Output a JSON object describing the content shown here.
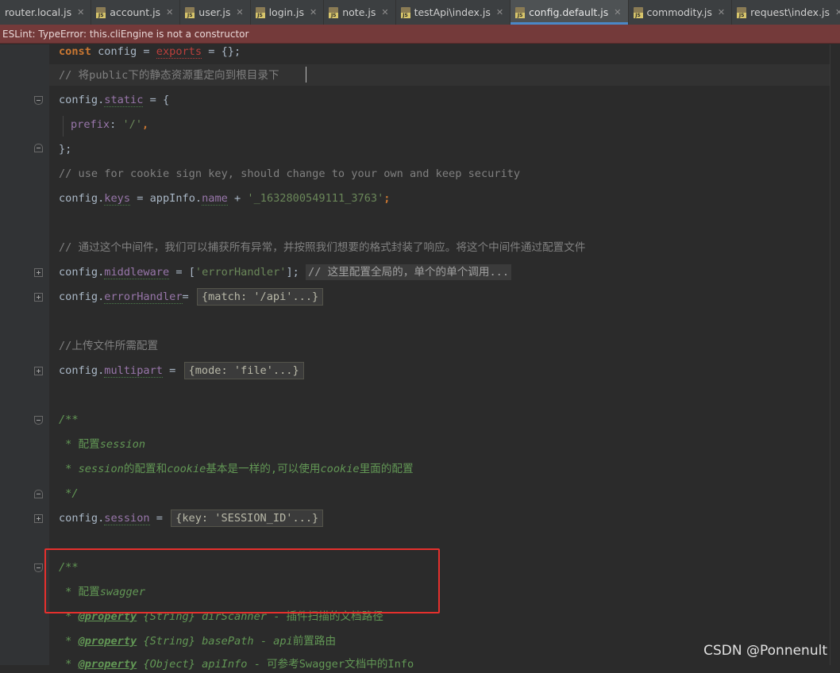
{
  "tabs": [
    {
      "label": "router.local.js",
      "active": false
    },
    {
      "label": "account.js",
      "active": false
    },
    {
      "label": "user.js",
      "active": false
    },
    {
      "label": "login.js",
      "active": false
    },
    {
      "label": "note.js",
      "active": false
    },
    {
      "label": "testApi\\index.js",
      "active": false
    },
    {
      "label": "config.default.js",
      "active": true
    },
    {
      "label": "commodity.js",
      "active": false
    },
    {
      "label": "request\\index.js",
      "active": false
    }
  ],
  "error_banner": "ESLint: TypeError: this.cliEngine is not a constructor",
  "code": {
    "l1_const": "const",
    "l1_a": " config = ",
    "l1_exports": "exports",
    "l1_b": " = {};",
    "l2": "// 将public下的静态资源重定向到根目录下",
    "l3_a": "config.",
    "l3_prop": "static",
    "l3_b": " = {",
    "l4_prop": "prefix",
    "l4_b": ": ",
    "l4_str": "'/'",
    "l4_c": ",",
    "l5": "};",
    "l6": "// use for cookie sign key, should change to your own and keep security",
    "l7_a": "config.",
    "l7_prop": "keys",
    "l7_b": " = appInfo.",
    "l7_name": "name",
    "l7_c": " + ",
    "l7_str": "'_1632800549111_3763'",
    "l7_d": ";",
    "l8": "// 通过这个中间件，我们可以捕获所有异常，并按照我们想要的格式封装了响应。将这个中间件通过配置文件",
    "l9_a": "config.",
    "l9_prop": "middleware",
    "l9_b": " = [",
    "l9_str": "'errorHandler'",
    "l9_c": "];",
    "l9_fold": "// 这里配置全局的，单个的单个调用...",
    "l10_a": "config.",
    "l10_prop": "errorHandler",
    "l10_b": "=",
    "l10_fold": "{match: '/api'...}",
    "l11": "//上传文件所需配置",
    "l12_a": "config.",
    "l12_prop": "multipart",
    "l12_b": " = ",
    "l12_fold": "{mode: 'file'...}",
    "l13": "/**",
    "l14_a": " * 配置",
    "l14_i": "session",
    "l15_a": " * ",
    "l15_i1": "session",
    "l15_b": "的配置和",
    "l15_i2": "cookie",
    "l15_c": "基本是一样的,可以使用",
    "l15_i3": "cookie",
    "l15_d": "里面的配置",
    "l16": " */",
    "l17_a": "config.",
    "l17_prop": "session",
    "l17_b": " = ",
    "l17_fold": "{key: 'SESSION_ID'...}",
    "l18": "/**",
    "l19_a": " * 配置",
    "l19_i": "swagger",
    "l20_a": " * ",
    "l20_tag": "@property",
    "l20_type": " {String}",
    "l20_name": " dirScanner",
    "l20_b": " - 插件扫描的文档路径",
    "l21_a": " * ",
    "l21_tag": "@property",
    "l21_type": " {String}",
    "l21_name": " basePath",
    "l21_b": " - ",
    "l21_i": "api",
    "l21_c": "前置路由",
    "l22_a": " * ",
    "l22_tag": "@property",
    "l22_type": " {Object}",
    "l22_name": " apiInfo",
    "l22_b": " - 可参考Swagger文档中的Info"
  },
  "watermark": "CSDN @Ponnenult",
  "colors": {
    "background": "#2b2b2b",
    "keyword": "#cc7832",
    "comment": "#808080",
    "string": "#6a8759",
    "property": "#9876aa",
    "doc_comment": "#629755",
    "error_banner": "#743a3a",
    "highlight_box": "#e5302d"
  }
}
